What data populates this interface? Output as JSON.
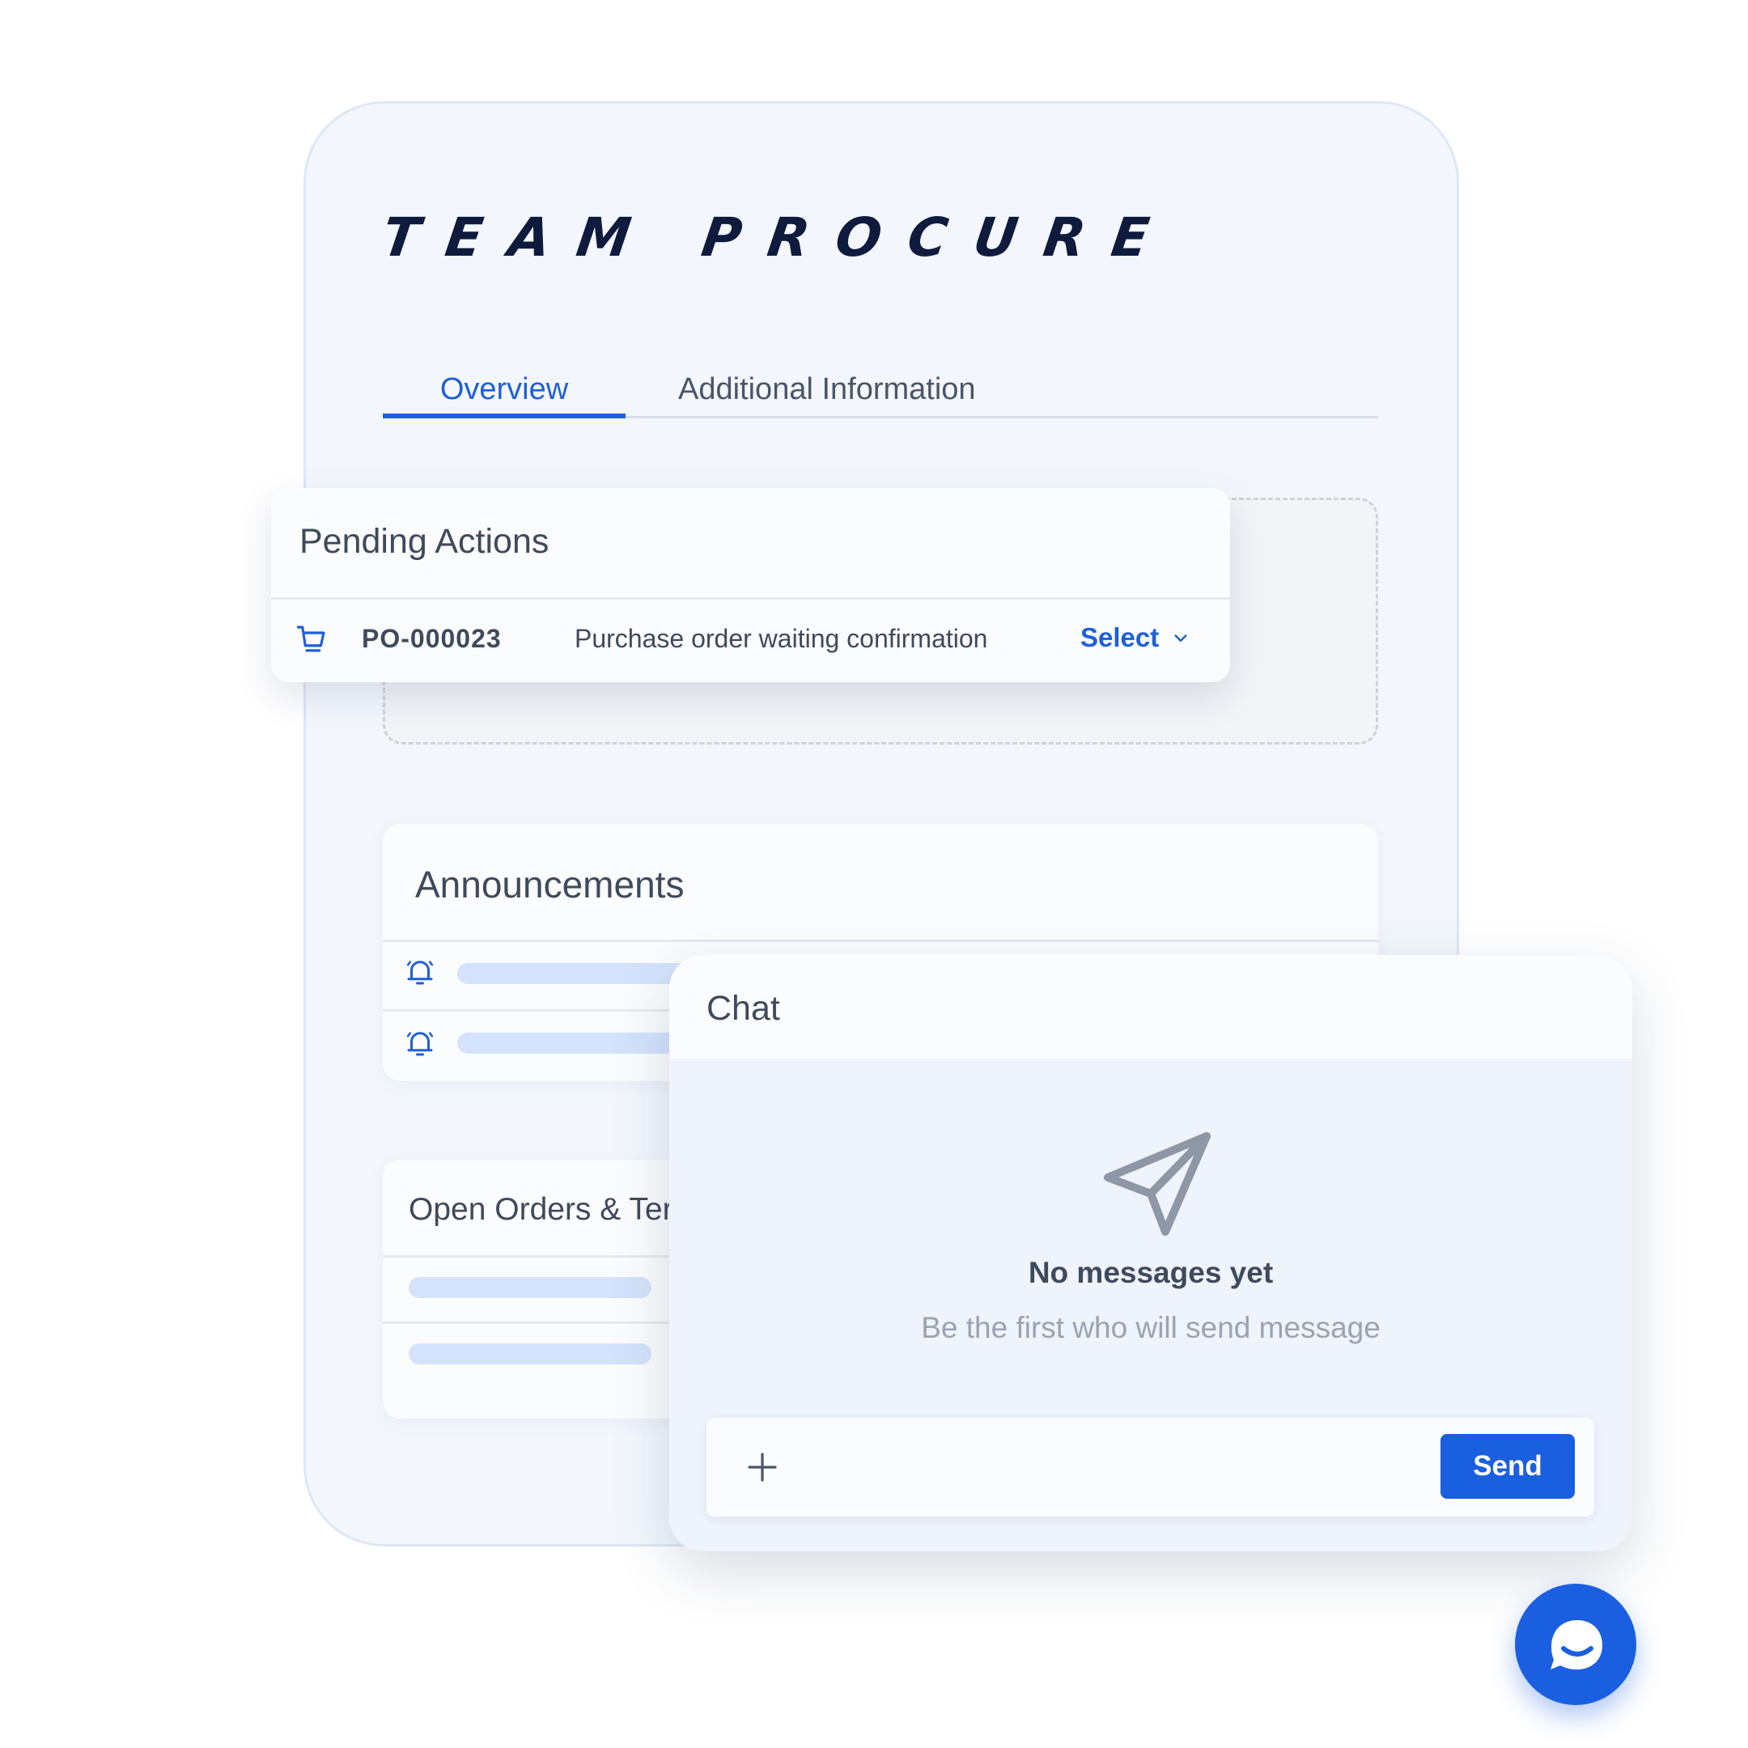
{
  "brand": {
    "logo_text": "TEAM PROCURE"
  },
  "tabs": [
    {
      "label": "Overview",
      "active": true
    },
    {
      "label": "Additional Information",
      "active": false
    }
  ],
  "pending_actions": {
    "title": "Pending Actions",
    "items": [
      {
        "icon": "cart-icon",
        "number": "PO-000023",
        "description": "Purchase order waiting confirmation",
        "action_label": "Select"
      }
    ]
  },
  "announcements": {
    "title": "Announcements",
    "row_icon": "bell-icon"
  },
  "open_orders": {
    "title": "Open Orders & Ter"
  },
  "chat": {
    "title": "Chat",
    "empty_icon": "paper-plane-icon",
    "empty_title": "No messages yet",
    "empty_subtitle": "Be the first who will send message",
    "add_icon": "plus-icon",
    "send_label": "Send"
  },
  "fab": {
    "icon": "chat-bubble-icon"
  },
  "colors": {
    "accent": "#1a5fe0",
    "tab_active": "#1f5fd9",
    "panel_bg": "#f3f7fd",
    "skeleton": "#d4e3fb",
    "text_dark": "#3f4a5c",
    "text_muted": "#9aa3b2",
    "logo": "#0f1b3d"
  }
}
